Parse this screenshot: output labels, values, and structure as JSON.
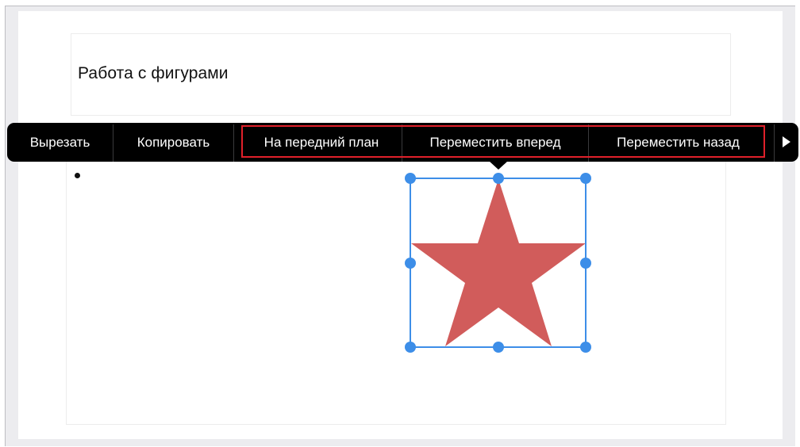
{
  "slide": {
    "title": "Работа с фигурами"
  },
  "context_menu": {
    "items": [
      {
        "label": "Вырезать"
      },
      {
        "label": "Копировать"
      },
      {
        "label": "На передний план"
      },
      {
        "label": "Переместить вперед"
      },
      {
        "label": "Переместить назад"
      }
    ],
    "more_icon": "triangle-right-icon"
  },
  "shape": {
    "type": "star",
    "fill_color": "#d15c5b",
    "selection_color": "#3d8ee8"
  },
  "colors": {
    "menu_background": "#000000",
    "highlight_border": "#e0202a"
  }
}
